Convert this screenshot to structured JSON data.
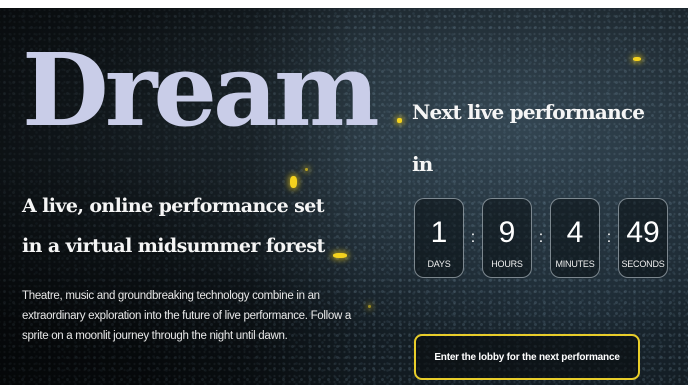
{
  "hero": {
    "title": "Dream",
    "subtitle": "A live, online performance set in a virtual midsummer forest",
    "description": "Theatre, music and groundbreaking technology combine in an extraordinary exploration into the future of live performance. Follow a sprite on a moonlit journey through the night until dawn."
  },
  "countdown": {
    "heading": "Next live performance in",
    "separator": ":",
    "units": [
      {
        "value": "1",
        "label": "DAYS"
      },
      {
        "value": "9",
        "label": "HOURS"
      },
      {
        "value": "4",
        "label": "MINUTES"
      },
      {
        "value": "49",
        "label": "SECONDS"
      }
    ]
  },
  "cta": {
    "label": "Enter the lobby for the next performance"
  },
  "colors": {
    "title": "#c9cde8",
    "accent": "#e8cd2a",
    "firefly": "#f4d21e"
  }
}
